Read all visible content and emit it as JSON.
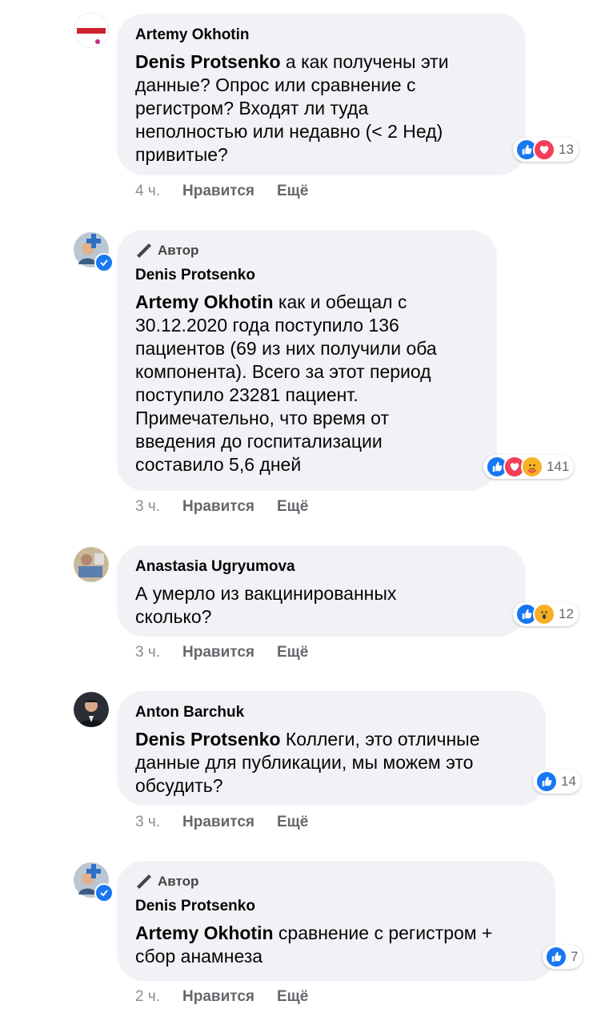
{
  "comments": [
    {
      "name": "Artemy Okhotin",
      "is_author": false,
      "mention": "Denis Protsenko",
      "text": " а как получены эти\nданные? Опрос или сравнение с\nрегистром? Входят ли туда\nнеполностью или недавно (< 2 Нед)\nпривитые?",
      "reactions": [
        "like",
        "love"
      ],
      "reaction_count": "13",
      "time": "4 ч.",
      "like_label": "Нравится",
      "more_label": "Ещё"
    },
    {
      "name": "Denis Protsenko",
      "is_author": true,
      "author_label": "Автор",
      "mention": "Artemy Okhotin",
      "text": " как и обещал с\n30.12.2020 года поступило 136\nпациентов (69 из них получили оба\nкомпонента). Всего за этот период\nпоступило 23281 пациент.\nПримечательно, что время от\nвведения до госпитализации\nсоставило 5,6 дней",
      "reactions": [
        "like",
        "love",
        "care"
      ],
      "reaction_count": "141",
      "time": "3 ч.",
      "like_label": "Нравится",
      "more_label": "Ещё"
    },
    {
      "name": "Anastasia Ugryumova",
      "is_author": false,
      "mention": "",
      "text": "А умерло из вакцинированных\nсколько?",
      "reactions": [
        "like",
        "wow"
      ],
      "reaction_count": "12",
      "time": "3 ч.",
      "like_label": "Нравится",
      "more_label": "Ещё"
    },
    {
      "name": "Anton Barchuk",
      "is_author": false,
      "mention": "Denis Protsenko",
      "text": " Коллеги, это отличные\nданные для публикации, мы можем это\nобсудить?",
      "reactions": [
        "like"
      ],
      "reaction_count": "14",
      "time": "3 ч.",
      "like_label": "Нравится",
      "more_label": "Ещё"
    },
    {
      "name": "Denis Protsenko",
      "is_author": true,
      "author_label": "Автор",
      "mention": "Artemy Okhotin",
      "text": " сравнение с регистром +\nсбор анамнеза",
      "reactions": [
        "like"
      ],
      "reaction_count": "7",
      "time": "2 ч.",
      "like_label": "Нравится",
      "more_label": "Ещё"
    }
  ],
  "colors": {
    "bubble": "#f0f2f5",
    "like": "#1877f2",
    "love": "#f33e58",
    "wow": "#f7b125",
    "meta_text": "#65676b"
  }
}
